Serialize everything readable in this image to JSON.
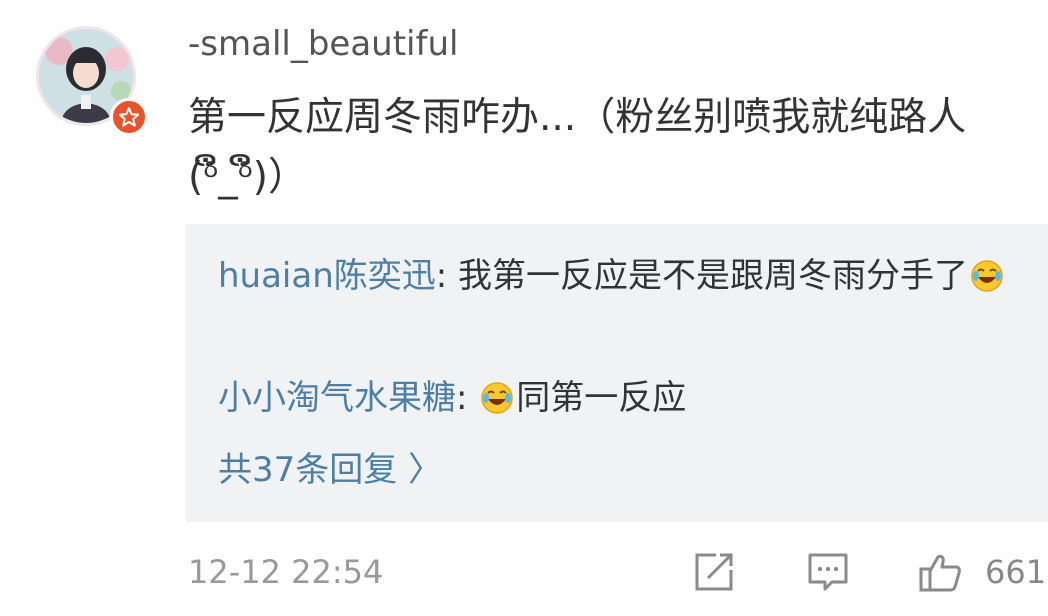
{
  "comment": {
    "username": "-small_beautiful",
    "text": "第一反应周冬雨咋办...（粉丝别喷我就纯路人(ᵟຶ_ᵟຶ)）",
    "timestamp": "12-12 22:54",
    "like_count": "661"
  },
  "replies": [
    {
      "name": "huaian陈奕迅",
      "separator": ": ",
      "text_before_emoji": "我第一反应是不是跟周冬雨分手了",
      "emoji": "laugh-cry-emoji",
      "text_after_emoji": ""
    },
    {
      "name": "小小淘气水果糖",
      "separator": ": ",
      "text_before_emoji": "",
      "emoji": "laugh-cry-emoji",
      "text_after_emoji": "同第一反应"
    }
  ],
  "more_replies": "共37条回复 〉",
  "icons": {
    "repost": "edit-share-icon",
    "comment": "comment-icon",
    "like": "thumbs-up-icon",
    "badge": "star-badge-icon"
  },
  "colors": {
    "link": "#4d7fa6",
    "text": "#333333",
    "muted": "#999999",
    "reply_bg": "#f0f2f4",
    "badge": "#e8532b"
  }
}
